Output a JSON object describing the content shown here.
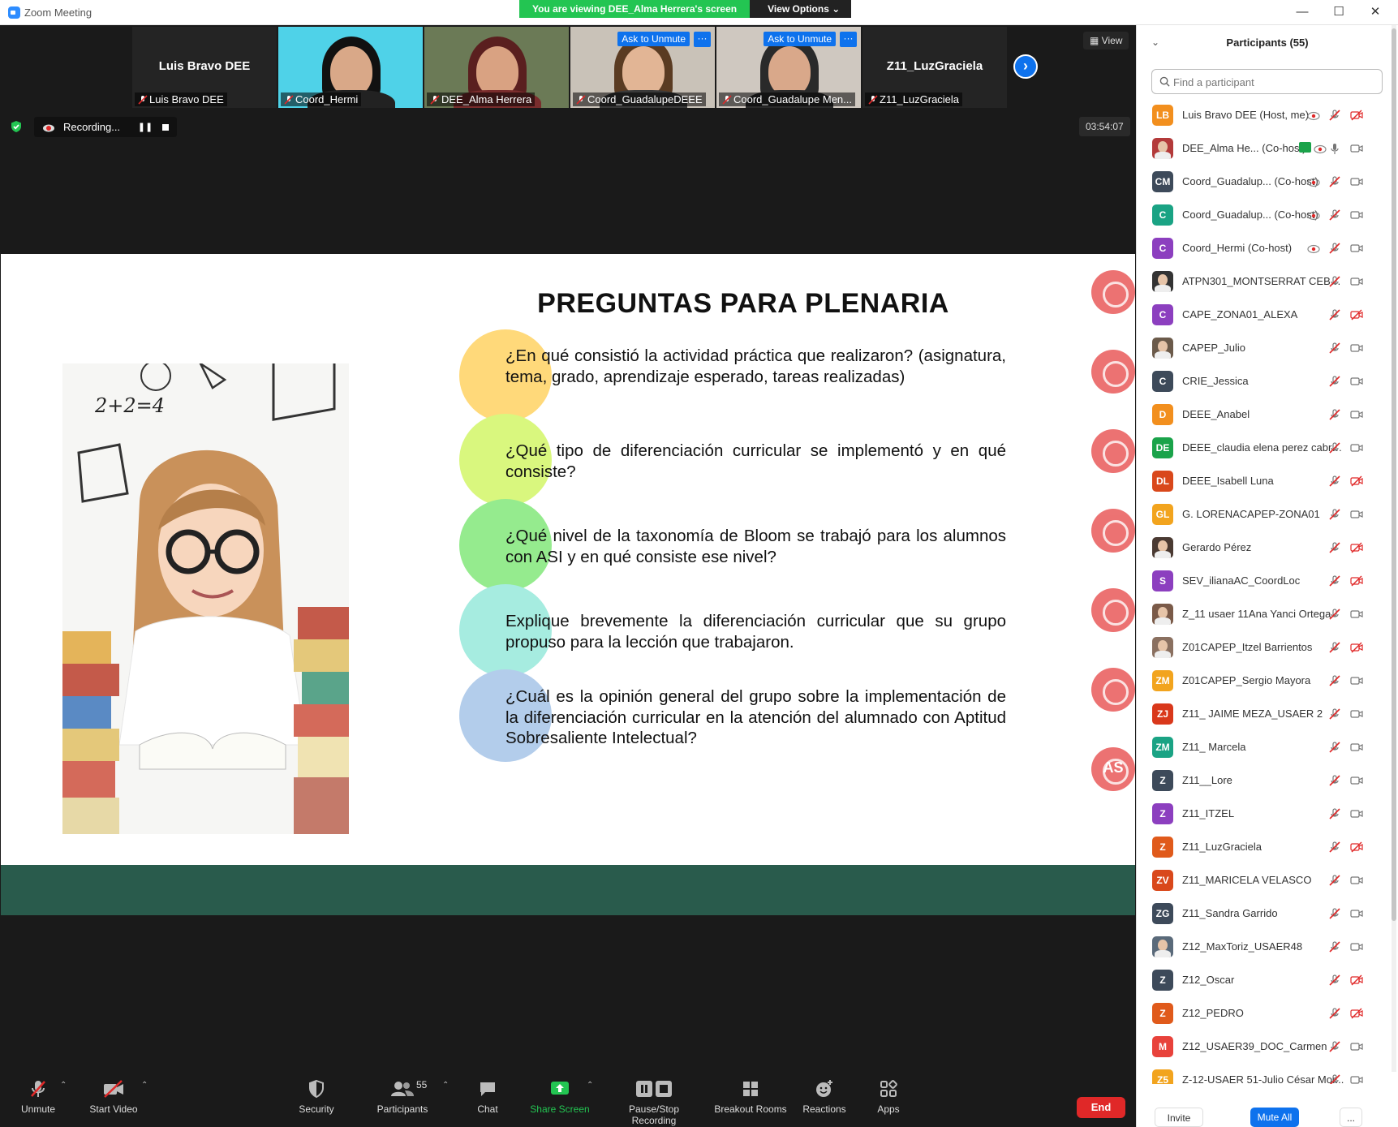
{
  "window": {
    "title": "Zoom Meeting",
    "minimize_glyph": "—",
    "maximize_glyph": "☐",
    "close_glyph": "✕"
  },
  "share_banner": {
    "viewing_text": "You are viewing DEE_Alma Herrera's screen",
    "options_label": "View Options ⌄"
  },
  "thumbnails": [
    {
      "name": "Luis Bravo DEE",
      "tag": "Luis Bravo DEE",
      "type": "name"
    },
    {
      "tag": "Coord_Hermi",
      "type": "video"
    },
    {
      "tag": "DEE_Alma Herrera",
      "type": "video"
    },
    {
      "tag": "Coord_GuadalupeDEEE",
      "type": "video",
      "ask": "Ask to Unmute"
    },
    {
      "tag": "Coord_Guadalupe Men...",
      "type": "video",
      "ask": "Ask to Unmute"
    },
    {
      "name": "Z11_LuzGraciela",
      "tag": "Z11_LuzGraciela",
      "type": "name"
    }
  ],
  "more_glyph": "···",
  "next_glyph": "›",
  "view_label": "View",
  "recording": {
    "label": "Recording...",
    "pause_glyph": "❚❚"
  },
  "timer": "03:54:07",
  "slide": {
    "title": "PREGUNTAS PARA PLENARIA",
    "questions": [
      {
        "text": "¿En qué consistió la actividad práctica que realizaron? (asignatura, tema, grado, aprendizaje esperado, tareas realizadas)",
        "color": "#ffd97a"
      },
      {
        "text": "¿Qué tipo de diferenciación curricular se implementó y en qué consiste?",
        "color": "#d9f77e"
      },
      {
        "text": "¿Qué nivel de la taxonomía de Bloom se trabajó para los alumnos con ASI y en qué consiste ese nivel?",
        "color": "#95eb8e"
      },
      {
        "text": "Explique brevemente la diferenciación curricular que su grupo propuso para la lección que trabajaron.",
        "color": "#a6ece0"
      },
      {
        "text": "¿Cuál es la opinión general del grupo sobre la implementación de la diferenciación curricular en la atención del alumnado con Aptitud Sobresaliente Intelectual?",
        "color": "#b3cdeb"
      }
    ],
    "photo_text": "2+2=4",
    "deco_last": "AS"
  },
  "toolbar": {
    "unmute": "Unmute",
    "start_video": "Start Video",
    "security": "Security",
    "participants": "Participants",
    "participants_count": "55",
    "chat": "Chat",
    "share_screen": "Share Screen",
    "pause_stop_recording": "Pause/Stop Recording",
    "breakout_rooms": "Breakout Rooms",
    "reactions": "Reactions",
    "apps": "Apps",
    "end": "End",
    "caret": "⌃"
  },
  "panel": {
    "title": "Participants (55)",
    "collapse_glyph": "⌄",
    "search_placeholder": "Find a participant",
    "invite": "Invite",
    "mute_all": "Mute All",
    "more": "..."
  },
  "participants": [
    {
      "initials": "LB",
      "color": "#f28f1e",
      "name": "Luis Bravo DEE (Host, me)",
      "rec": true,
      "video": "off"
    },
    {
      "initials": "",
      "color": "#b33a3a",
      "photo": true,
      "name": "DEE_Alma He...   (Co-host)",
      "rec": true,
      "share": true,
      "mic": "on",
      "video": "on"
    },
    {
      "initials": "CM",
      "color": "#3d4a5a",
      "name": "Coord_Guadalup...   (Co-host)",
      "rec": true,
      "video": "on"
    },
    {
      "initials": "C",
      "color": "#1aa384",
      "name": "Coord_Guadalup...   (Co-host)",
      "rec": true,
      "video": "on"
    },
    {
      "initials": "C",
      "color": "#8c3fbf",
      "name": "Coord_Hermi (Co-host)",
      "rec": true,
      "video": "on"
    },
    {
      "initials": "",
      "color": "#333333",
      "photo": true,
      "name": "ATPN301_MONTSERRAT CEBALL...",
      "video": "on"
    },
    {
      "initials": "C",
      "color": "#8c3fbf",
      "name": "CAPE_ZONA01_ALEXA",
      "video": "off"
    },
    {
      "initials": "",
      "color": "#6b5a4a",
      "photo": true,
      "name": "CAPEP_Julio",
      "video": "on"
    },
    {
      "initials": "C",
      "color": "#3d4a5a",
      "name": "CRIE_Jessica",
      "video": "on"
    },
    {
      "initials": "D",
      "color": "#f28f1e",
      "name": "DEEE_Anabel",
      "video": "on"
    },
    {
      "initials": "DE",
      "color": "#1aa34a",
      "name": "DEEE_claudia elena perez cabre...",
      "video": "on"
    },
    {
      "initials": "DL",
      "color": "#d9481b",
      "name": "DEEE_Isabell Luna",
      "video": "off"
    },
    {
      "initials": "GL",
      "color": "#f2a41e",
      "name": "G. LORENACAPEP-ZONA01",
      "video": "on"
    },
    {
      "initials": "",
      "color": "#4a3a32",
      "photo": true,
      "name": "Gerardo Pérez",
      "video": "off"
    },
    {
      "initials": "S",
      "color": "#8c3fbf",
      "name": "SEV_ilianaAC_CoordLoc",
      "video": "off"
    },
    {
      "initials": "",
      "color": "#7a5a48",
      "photo": true,
      "name": "Z_11 usaer 11Ana Yanci Ortega",
      "video": "on"
    },
    {
      "initials": "",
      "color": "#8a7060",
      "photo": true,
      "name": "Z01CAPEP_Itzel Barrientos",
      "video": "off"
    },
    {
      "initials": "ZM",
      "color": "#f2a41e",
      "name": "Z01CAPEP_Sergio Mayora",
      "video": "on"
    },
    {
      "initials": "ZJ",
      "color": "#d9381b",
      "name": "Z11_ JAIME MEZA_USAER 2",
      "video": "on"
    },
    {
      "initials": "ZM",
      "color": "#1aa384",
      "name": "Z11_ Marcela",
      "video": "on"
    },
    {
      "initials": "Z",
      "color": "#3d4a5a",
      "name": "Z11__Lore",
      "video": "on"
    },
    {
      "initials": "Z",
      "color": "#8c3fbf",
      "name": "Z11_ITZEL",
      "video": "on"
    },
    {
      "initials": "Z",
      "color": "#e05a1b",
      "name": "Z11_LuzGraciela",
      "video": "off"
    },
    {
      "initials": "ZV",
      "color": "#d9481b",
      "name": "Z11_MARICELA VELASCO",
      "video": "on"
    },
    {
      "initials": "ZG",
      "color": "#3d4a5a",
      "name": "Z11_Sandra Garrido",
      "video": "on"
    },
    {
      "initials": "",
      "color": "#5a6a7a",
      "photo": true,
      "name": "Z12_MaxToriz_USAER48",
      "video": "on"
    },
    {
      "initials": "Z",
      "color": "#3d4a5a",
      "name": "Z12_Oscar",
      "video": "off"
    },
    {
      "initials": "Z",
      "color": "#e05a1b",
      "name": "Z12_PEDRO",
      "video": "off"
    },
    {
      "initials": "M",
      "color": "#e8423b",
      "name": "Z12_USAER39_DOC_Carmen",
      "video": "on"
    },
    {
      "initials": "Z5",
      "color": "#f2a41e",
      "name": "Z-12-USAER 51-Julio César Mor...",
      "video": "on"
    }
  ]
}
